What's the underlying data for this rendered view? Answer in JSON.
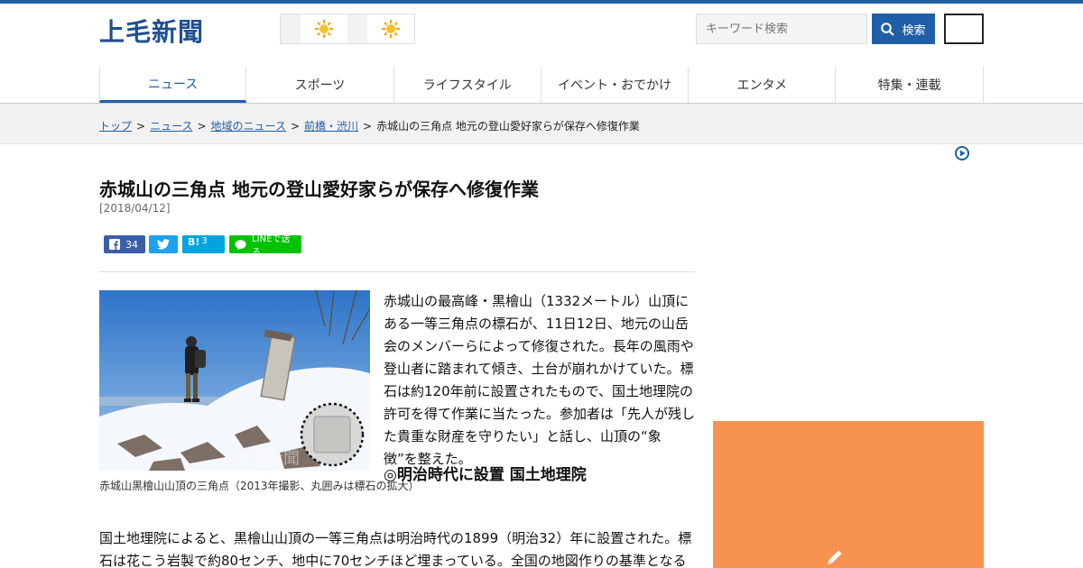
{
  "header": {
    "logo": "上毛新聞",
    "search_placeholder": "キーワード検索",
    "search_button": "検索"
  },
  "nav": [
    "ニュース",
    "スポーツ",
    "ライフスタイル",
    "イベント・おでかけ",
    "エンタメ",
    "特集・連載"
  ],
  "breadcrumb": {
    "items": [
      "トップ",
      "ニュース",
      "地域のニュース",
      "前橋・渋川"
    ],
    "separator": ">",
    "current": "赤城山の三角点 地元の登山愛好家らが保存へ修復作業"
  },
  "article": {
    "title": "赤城山の三角点 地元の登山愛好家らが保存へ修復作業",
    "date": "[2018/04/12]",
    "share": {
      "facebook_count": "34",
      "hatena_label": "B!",
      "hatena_count": "3",
      "line_label": "LINEで送る"
    },
    "photo_caption": "赤城山黒檜山山頂の三角点（2013年撮影、丸囲みは標石の拡大）",
    "photo_watermark": "上毛新聞",
    "lead": "赤城山の最高峰・黒檜山（1332メートル）山頂にある一等三角点の標石が、11日12日、地元の山岳会のメンバーらによって修復された。長年の風雨や登山者に踏まれて傾き、土台が崩れかけていた。標石は約120年前に設置されたもので、国土地理院の許可を得て作業に当たった。参加者は「先人が残した貴重な財産を守りたい」と話し、山頂の“象徴”を整えた。",
    "subhead": "◎明治時代に設置 国土地理院",
    "body": "国土地理院によると、黒檜山山頂の一等三角点は明治時代の1899（明治32）年に設置された。標石は花こう岩製で約80センチ、地中に70センチほど埋まっている。全国の地図作りの基準となる重要な測量点で、現在も位置情報の基準として活用されている。"
  },
  "colors": {
    "brand": "#1f5fa8",
    "ad": "#f79250"
  }
}
